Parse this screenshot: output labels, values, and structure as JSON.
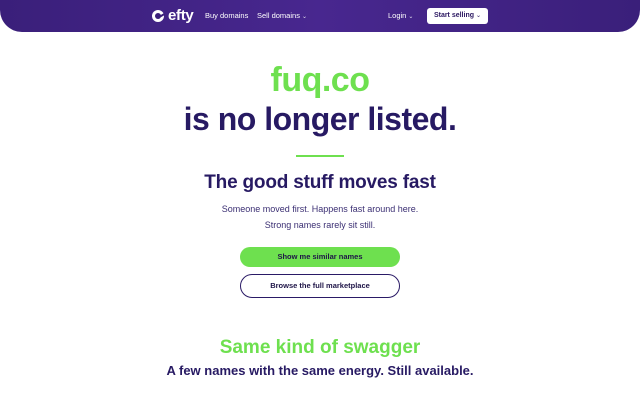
{
  "header": {
    "logo_text": "efty",
    "nav": {
      "buy": "Buy domains",
      "sell": "Sell domains",
      "login": "Login"
    },
    "start_selling": "Start selling"
  },
  "hero": {
    "domain": "fuq.co",
    "status": "is no longer listed.",
    "subhead": "The good stuff moves fast",
    "line1": "Someone moved first. Happens fast around here.",
    "line2": "Strong names rarely sit still.",
    "primary_button": "Show me similar names",
    "secondary_button": "Browse the full marketplace"
  },
  "section": {
    "title": "Same kind of swagger",
    "subtitle": "A few names with the same energy. Still available."
  },
  "colors": {
    "brand_purple": "#3a1f7a",
    "accent_green": "#6ee04f",
    "text_dark": "#271a63"
  },
  "icons": {
    "chevron": "chevron-down-icon",
    "logo": "efty-logo-icon"
  }
}
